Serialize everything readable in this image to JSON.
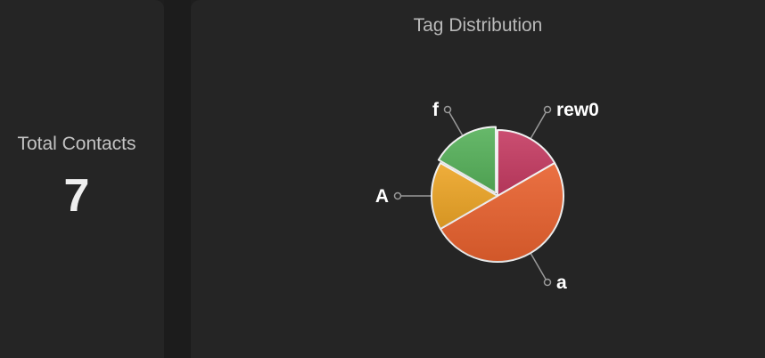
{
  "stats": {
    "label": "Total Contacts",
    "value": "7"
  },
  "chart_data": {
    "type": "pie",
    "title": "Tag Distribution",
    "slices": [
      {
        "label": "rew0",
        "value": 1,
        "color": "#c53b62"
      },
      {
        "label": "a",
        "value": 3,
        "color": "#e8612e"
      },
      {
        "label": "A",
        "value": 1,
        "color": "#eda526"
      },
      {
        "label": "f",
        "value": 1,
        "color": "#56b15a"
      }
    ]
  }
}
